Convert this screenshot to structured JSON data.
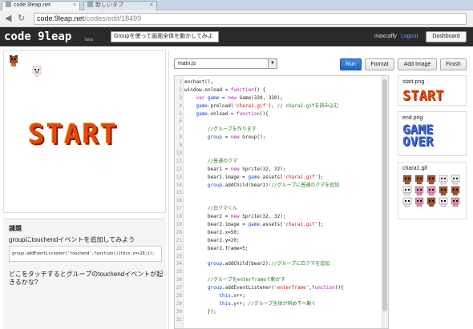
{
  "browser": {
    "tabs": [
      {
        "label": "code.9leap.net",
        "active": true
      },
      {
        "label": "新しいタブ",
        "active": false
      }
    ],
    "url_host": "code.9leap.net",
    "url_path": "/codes/edit/18499"
  },
  "app": {
    "logo": "code 9leap",
    "beta": "beta",
    "title": "Groupを使って画面全体を動かしてみよ",
    "user": "maxcaffy",
    "logout": "Logout",
    "dashboard": "Dashboard"
  },
  "game": {
    "start_text": "START"
  },
  "lesson": {
    "heading": "課題",
    "instruction": "groupにtouchendイベントを追加してみよう",
    "code": "group.addEventListener('touchend',function(){this.x=+10;});",
    "question": "どこをタッチするとグループのtouchendイベントが起きるかな?"
  },
  "editor": {
    "file": "main.js",
    "run": "Run",
    "format": "Format",
    "add_image": "Add Image",
    "finish": "Finish",
    "lines": [
      "enchant();",
      "window.onload = function() {",
      "    var game = new Game(320, 320);",
      "    game.preload('chara1.gif'); // chara1.gifを読み込む",
      "    game.onload = function(){",
      "",
      "        //グループを作ります",
      "        group = new Group();",
      "",
      "",
      "        //普通のクマ",
      "        bear1 = new Sprite(32, 32);",
      "        bear1.image = game.assets['chara1.gif'];",
      "        group.addChild(bear1)://グループに普通のクマを追加",
      "",
      "",
      "        //白クマくん",
      "        bear2 = new Sprite(32, 32);",
      "        bear2.image = game.assets['chara1.gif'];",
      "        bear2.x=50;",
      "        bear2.y=20;",
      "        bear2.frame=5;",
      "",
      "        group.addChild(bear2)://グループに白クマを追加",
      "",
      "        //グループをenterframeで動かす",
      "        group.addEventListener('enterframe',function(){",
      "            this.x++;",
      "            this.y++; //グループ全体が斜め下へ動く",
      "        });",
      ""
    ]
  },
  "assets": [
    {
      "name": "start.png",
      "art": "START"
    },
    {
      "name": "end.png",
      "art_line1": "GAME",
      "art_line2": "OVER"
    },
    {
      "name": "chara1.gif"
    }
  ]
}
